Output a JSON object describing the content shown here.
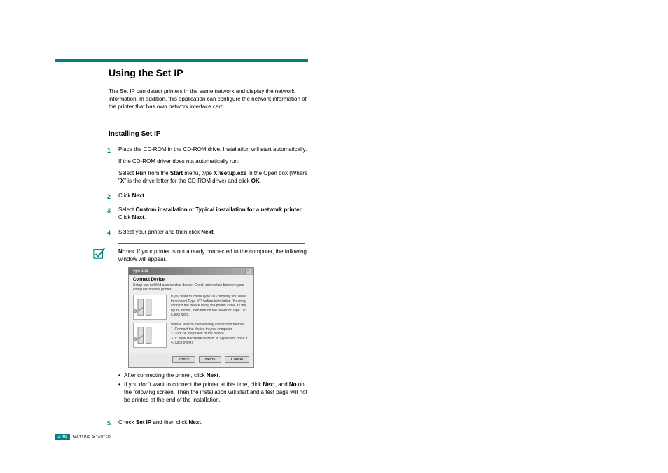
{
  "heading": "Using the Set IP",
  "intro": "The Set IP can detect printers in the same network and display the network information. In addition, this application can configure the network information of the printer that has own network interface card.",
  "subheading": "Installing Set IP",
  "steps": {
    "s1_a": "Place the CD-ROM in the CD-ROM drive. Installation will start automatically.",
    "s1_b": "If the CD-ROM driver does not automatically run:",
    "s1_c_pre": "Select ",
    "s1_run": "Run",
    "s1_c_mid1": " from the ",
    "s1_start": "Start",
    "s1_c_mid2": " menu, type ",
    "s1_path": "X:\\setup.exe",
    "s1_c_mid3": " in the Open box (Where \"",
    "s1_x": "X",
    "s1_c_mid4": "\" is the drive letter for the CD-ROM drive) and click ",
    "s1_ok": "OK",
    "s1_c_end": ".",
    "s2_a": "Click ",
    "s2_next": "Next",
    "s2_b": ".",
    "s3_a": "Select ",
    "s3_custom": "Custom installation",
    "s3_b": " or ",
    "s3_typical": "Typical installation for a network printer",
    "s3_c": ". Click ",
    "s3_next": "Next",
    "s3_d": ".",
    "s4_a": "Select your printer and then click ",
    "s4_next": "Next",
    "s4_b": ".",
    "s5_a": "Check ",
    "s5_setip": "Set IP",
    "s5_b": " and then click ",
    "s5_next": "Next",
    "s5_c": "."
  },
  "note": {
    "label": "Notes",
    "text": ": If your printer is not already connected to the computer, the following window will appear."
  },
  "dialog": {
    "title": "Type 103",
    "header": "Connect Device",
    "sub": "Setup can not find a connected device. Check connection between your computer and the printer.",
    "right1": "If you want to install Type 103 properly you have to connect Type 103 before installation. You may connect the device using the printer cable as the figure shows, then turn on the power of Type 103. Click [Next].",
    "right2a": "Please refer to the following connection method.",
    "right2b": "1. Connect the device to your computer.",
    "right2c": "2. Turn on the power of the device.",
    "right2d": "3. If \"New Hardware Wizard\" is appeared, close it.",
    "right2e": "4. Click [Next].",
    "btn_back": "<Back",
    "btn_next": "Next>",
    "btn_cancel": "Cancel"
  },
  "bullets": {
    "b1_a": "After connecting the printer, click ",
    "b1_next": "Next",
    "b1_b": ".",
    "b2_a": "If you don't want to connect the printer at this time, click ",
    "b2_next": "Next",
    "b2_b": ", and ",
    "b2_no": "No",
    "b2_c": " on the following screen. Then the installation will start and a test page will not be printed at the end of the installation."
  },
  "footer": {
    "page": "2.46",
    "section": "Getting Started"
  }
}
